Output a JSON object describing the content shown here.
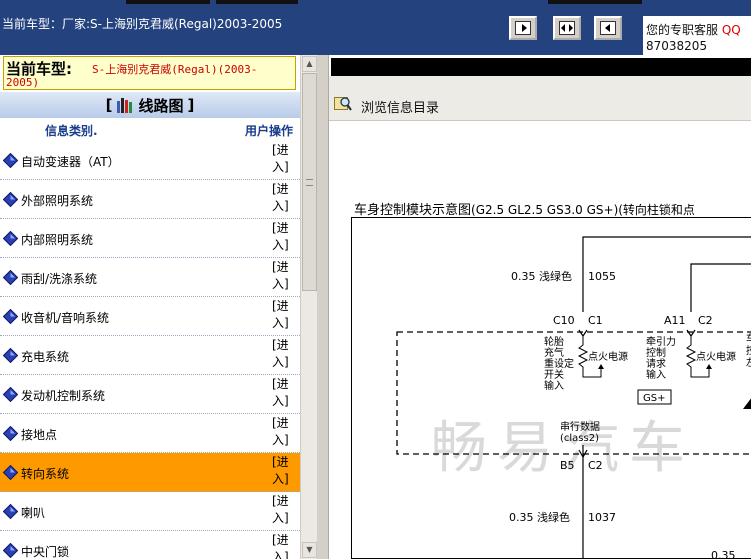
{
  "header": {
    "title": "当前车型：厂家:S-上海别克君威(Regal)2003-2005",
    "support_label": "您的专职客服",
    "support_qq": "QQ",
    "support_number": "87038205",
    "nav_buttons": [
      "previous-page",
      "fit-page",
      "next-page"
    ]
  },
  "current_car": {
    "label": "当前车型:",
    "value_line1": "S-上海别克君威(Regal)(2003-",
    "value_line2": "2005)"
  },
  "section": {
    "bracket_open": "[",
    "title": "线路图",
    "bracket_close": "]"
  },
  "table": {
    "col_category": "信息类别.",
    "col_action": "用户操作",
    "action_line1": "[进",
    "action_line2": "入]",
    "rows": [
      {
        "name": "自动变速器（AT）",
        "selected": false
      },
      {
        "name": "外部照明系统",
        "selected": false
      },
      {
        "name": "内部照明系统",
        "selected": false
      },
      {
        "name": "雨刮/洗涤系统",
        "selected": false
      },
      {
        "name": "收音机/音响系统",
        "selected": false
      },
      {
        "name": "充电系统",
        "selected": false
      },
      {
        "name": "发动机控制系统",
        "selected": false
      },
      {
        "name": "接地点",
        "selected": false
      },
      {
        "name": "转向系统",
        "selected": true
      },
      {
        "name": "喇叭",
        "selected": false
      },
      {
        "name": "中央门锁",
        "selected": false
      }
    ]
  },
  "viewer": {
    "browse_label": "浏览信息目录",
    "diagram_title_cn1": "车身控制模块示意图",
    "diagram_title_paren": "(G2.5 GL2.5 GS3.0 GS+)(转向柱锁和点",
    "diagram": {
      "wire1": "0.35 浅绿色",
      "circuit1": "1055",
      "pin_c10": "C10",
      "pin_c1": "C1",
      "pin_a11": "A11",
      "pin_c2": "C2",
      "input1": [
        "轮胎",
        "充气",
        "重设定",
        "开关",
        "输入"
      ],
      "input2": [
        "牵引力",
        "控制",
        "请求",
        "输入"
      ],
      "supply": "点火电源",
      "badge": "GS+",
      "serial_label": "串行数据",
      "serial_class": "(class2)",
      "pin_b5": "B5",
      "pin_c2b": "C2",
      "wire2": "0.35 浅绿色",
      "circuit2": "1037",
      "wire3": "0.35",
      "right_text": [
        "车",
        "控",
        "左"
      ],
      "watermark": "畅易汽车"
    }
  },
  "colors": {
    "header_bg": "#24427e",
    "selected_row": "#ff9900",
    "current_car_bg": "#ffffcc",
    "current_car_value": "#cc0000",
    "category_header": "#1a3e8c"
  }
}
